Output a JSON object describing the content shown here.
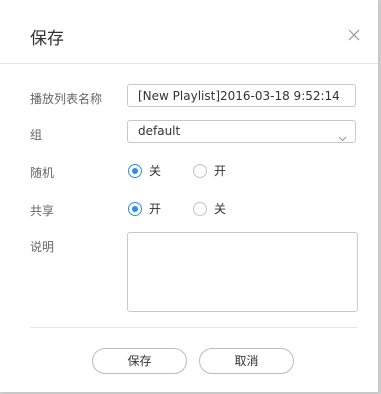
{
  "dialog": {
    "title": "保存",
    "close_icon": "close-icon"
  },
  "form": {
    "name": {
      "label": "播放列表名称",
      "value": "[New Playlist]2016-03-18 9:52:14"
    },
    "group": {
      "label": "组",
      "selected": "default",
      "icon": "chevron-down-icon"
    },
    "random": {
      "label": "随机",
      "options": [
        {
          "label": "关",
          "checked": true
        },
        {
          "label": "开",
          "checked": false
        }
      ]
    },
    "shared": {
      "label": "共享",
      "options": [
        {
          "label": "开",
          "checked": true
        },
        {
          "label": "关",
          "checked": false
        }
      ]
    },
    "description": {
      "label": "说明",
      "value": ""
    }
  },
  "buttons": {
    "save": "保存",
    "cancel": "取消"
  },
  "colors": {
    "accent": "#2d8cf0",
    "border": "#c9c9c9"
  }
}
